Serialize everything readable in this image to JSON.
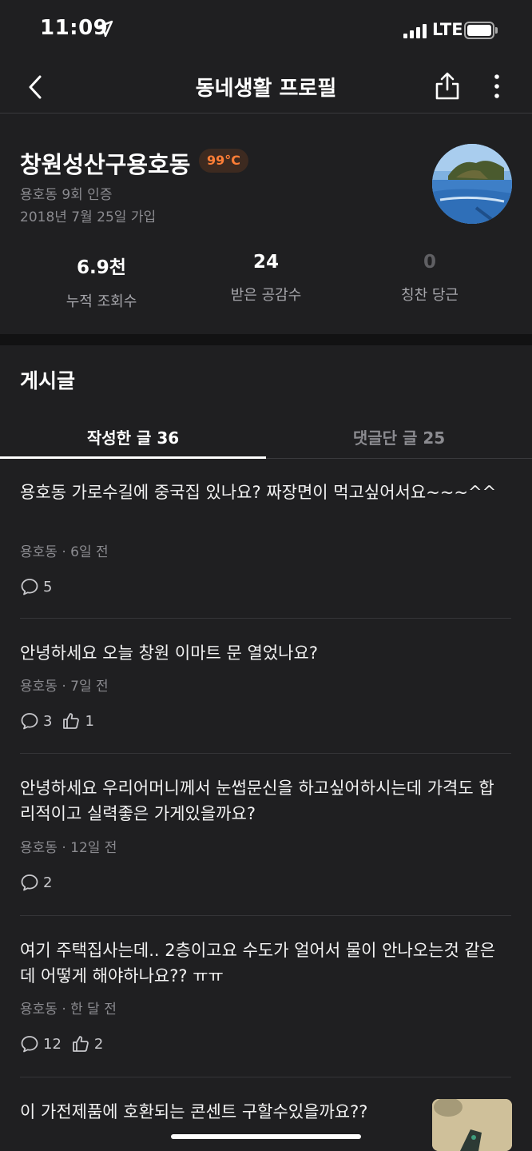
{
  "status_bar": {
    "time": "11:09",
    "network": "LTE"
  },
  "app_bar": {
    "title": "동네생활 프로필"
  },
  "profile": {
    "nickname": "창원성산구용호동",
    "temperature": "99°C",
    "certification": "용호동 9회 인증",
    "joined": "2018년 7월 25일 가입",
    "stats": [
      {
        "value": "6.9천",
        "label": "누적 조회수"
      },
      {
        "value": "24",
        "label": "받은 공감수"
      },
      {
        "value": "0",
        "label": "칭찬 당근"
      }
    ]
  },
  "section": {
    "title": "게시글"
  },
  "tabs": {
    "written": "작성한 글 36",
    "commented": "댓글단 글 25"
  },
  "posts": [
    {
      "title": "용호동 가로수길에 중국집 있나요? 짜장면이 먹고싶어서요~~~^^",
      "meta": "용호동 · 6일 전",
      "comments": "5",
      "likes": ""
    },
    {
      "title": "안녕하세요 오늘 창원 이마트 문 열었나요?",
      "meta": "용호동 · 7일 전",
      "comments": "3",
      "likes": "1"
    },
    {
      "title": "안녕하세요 우리어머니께서 눈썹문신을 하고싶어하시는데 가격도 합리적이고 실력좋은 가게있을까요?",
      "meta": "용호동 · 12일 전",
      "comments": "2",
      "likes": ""
    },
    {
      "title": "여기 주택집사는데.. 2층이고요 수도가 얼어서 물이 안나오는것 같은데 어떻게 해야하나요?? ㅠㅠ",
      "meta": "용호동 · 한 달 전",
      "comments": "12",
      "likes": "2"
    },
    {
      "title": "이 가전제품에 호환되는 콘센트 구할수있을까요??",
      "meta": "",
      "comments": "",
      "likes": ""
    }
  ],
  "colors": {
    "accent": "#ff7e36",
    "background": "#1f1f21",
    "muted": "#8b8b90"
  }
}
